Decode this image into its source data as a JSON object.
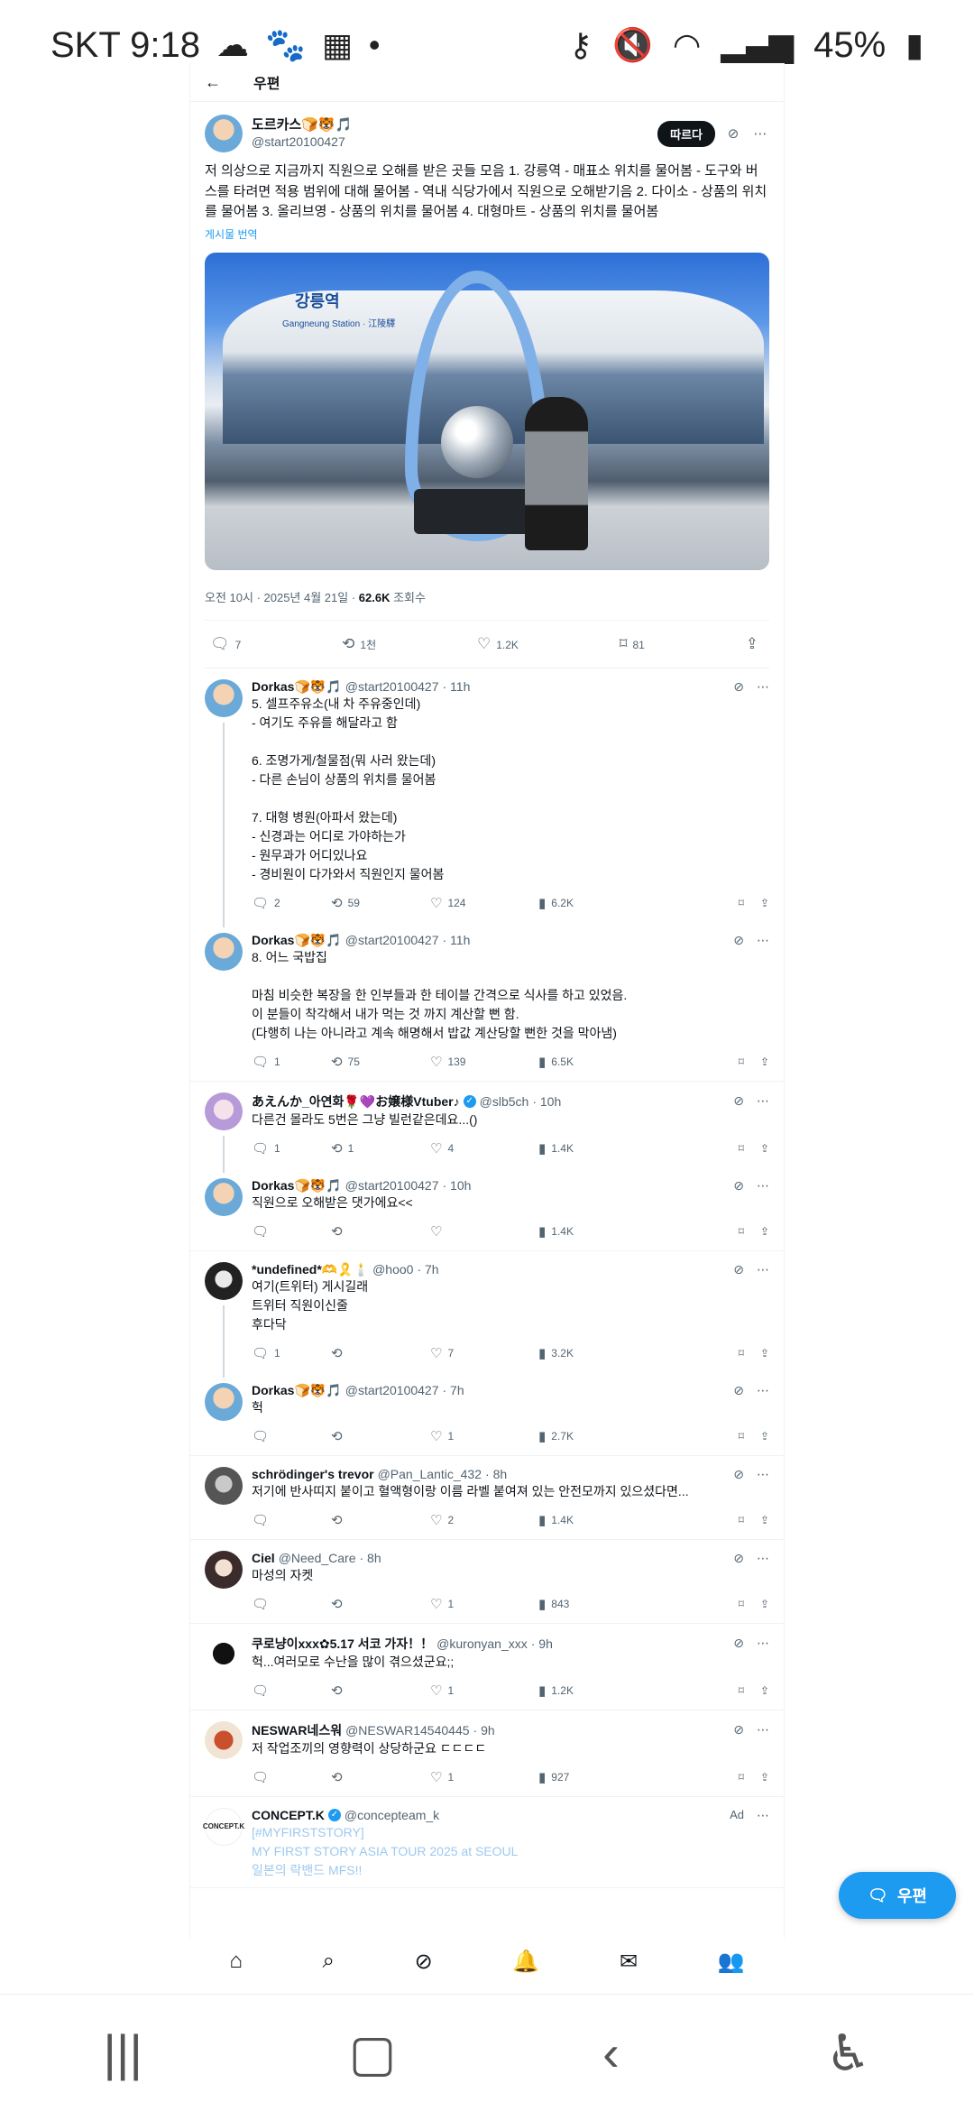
{
  "status_bar": {
    "carrier_time": "SKT 9:18",
    "battery": "45%",
    "icons": [
      "cloud-icon",
      "paw-icon",
      "calendar-icon",
      "dot-icon",
      "key-icon",
      "mute-icon",
      "wifi-icon",
      "signal-icon",
      "battery-icon"
    ]
  },
  "header": {
    "title": "우편"
  },
  "post": {
    "name": "도르카스🍞🐯🎵",
    "handle": "@start20100427",
    "follow_label": "따르다",
    "text": "저 의상으로 지금까지 직원으로 오해를 받은 곳들 모음 1. 강릉역 - 매표소 위치를 물어봄 - 도구와 버스를 타려면 적용 범위에 대해 물어봄 - 역내 식당가에서 직원으로 오해받기음 2. 다이소 - 상품의 위치를 물어봄 3. 올리브영 - 상품의 위치를 물어봄 4. 대형마트 - 상품의 위치를 물어봄",
    "translate_label": "게시물 번역",
    "photo_sign": "강릉역",
    "photo_sign_en": "Gangneung Station · 江陵驛",
    "time": "오전 10시 · 2025년 4월 21일 · ",
    "views": "62.6K",
    "views_label": " 조회수",
    "replies": "7",
    "reposts": "1천",
    "likes": "1.2K",
    "bookmarks": "81"
  },
  "replies": [
    {
      "name": "Dorkas🍞🐯🎵",
      "handle": "@start20100427",
      "time": "· 11h",
      "text": "5. 셀프주유소(내 차 주유중인데)\n- 여기도 주유를 해달라고 함\n\n6. 조명가게/철물점(뭐 사러 왔는데)\n- 다른 손님이 상품의 위치를 물어봄\n\n7. 대형 병원(아파서 왔는데)\n- 신경과는 어디로 가야하는가\n- 원무과가 어디있나요\n- 경비원이 다가와서 직원인지 물어봄",
      "replies": "2",
      "reposts": "59",
      "likes": "124",
      "views": "6.2K"
    },
    {
      "name": "Dorkas🍞🐯🎵",
      "handle": "@start20100427",
      "time": "· 11h",
      "text": "8. 어느 국밥집\n\n마침 비슷한 복장을 한 인부들과 한 테이블 간격으로 식사를 하고 있었음.\n이 분들이 착각해서 내가 먹는 것 까지 계산할 뻔 함.\n(다행히 나는 아니라고 계속 해명해서 밥값 계산당할 뻔한 것을 막아냄)",
      "replies": "1",
      "reposts": "75",
      "likes": "139",
      "views": "6.5K"
    },
    {
      "name": "あえんか_아연화🌹💜お嬢様Vtuber♪",
      "handle": "@slb5ch",
      "time": "· 10h",
      "text": "다른건 몰라도 5번은 그냥 빌런같은데요...()",
      "replies": "1",
      "reposts": "1",
      "likes": "4",
      "views": "1.4K"
    },
    {
      "name": "Dorkas🍞🐯🎵",
      "handle": "@start20100427",
      "time": "· 10h",
      "text": "직원으로 오해받은 댓가에요<<",
      "replies": "",
      "reposts": "",
      "likes": "",
      "views": "1.4K"
    },
    {
      "name": "*undefined*🫶🎗️🕯️",
      "handle": "@hoo0",
      "time": "· 7h",
      "text": "여기(트위터) 게시길래\n트위터 직원이신줄\n후다닥",
      "replies": "1",
      "reposts": "",
      "likes": "7",
      "views": "3.2K"
    },
    {
      "name": "Dorkas🍞🐯🎵",
      "handle": "@start20100427",
      "time": "· 7h",
      "text": "헉",
      "replies": "",
      "reposts": "",
      "likes": "1",
      "views": "2.7K"
    },
    {
      "name": "schrödinger's trevor",
      "handle": "@Pan_Lantic_432",
      "time": "· 8h",
      "text": "저기에 반사띠지 붙이고 혈액형이랑 이름 라벨 붙여져 있는 안전모까지 있으셨다면...",
      "replies": "",
      "reposts": "",
      "likes": "2",
      "views": "1.4K"
    },
    {
      "name": "Ciel",
      "handle": "@Need_Care",
      "time": "· 8h",
      "text": "마성의 자켓",
      "replies": "",
      "reposts": "",
      "likes": "1",
      "views": "843"
    },
    {
      "name": "쿠로냥이xxx✿5.17 서코 가자！！",
      "handle": "@kuronyan_xxx",
      "time": "· 9h",
      "text": "헉...여러모로 수난을 많이 겪으셨군요;;",
      "replies": "",
      "reposts": "",
      "likes": "1",
      "views": "1.2K"
    },
    {
      "name": "NESWAR네스워",
      "handle": "@NESWAR14540445",
      "time": "· 9h",
      "text": "저 작업조끼의 영향력이 상당하군요 ㄷㄷㄷㄷ",
      "replies": "",
      "reposts": "",
      "likes": "1",
      "views": "927"
    },
    {
      "name": "CONCEPT.K",
      "handle": "@concepteam_k",
      "time": "",
      "ad": "Ad",
      "text": "[#MYFIRSTSTORY]\nMY FIRST STORY ASIA TOUR 2025 at SEOUL\n일본의 락밴드 MFS!!"
    }
  ],
  "fab_label": "우편"
}
